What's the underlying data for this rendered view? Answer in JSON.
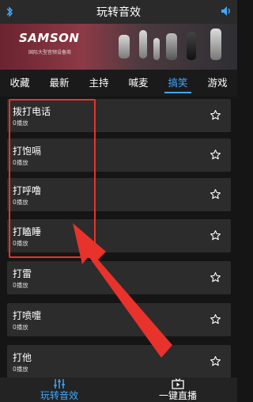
{
  "header": {
    "title": "玩转音效",
    "left_icon": "bluetooth-icon",
    "right_icon": "volume-icon"
  },
  "banner": {
    "brand": "SAMSON",
    "subtitle": "国际大型音频设备商"
  },
  "tabs": [
    {
      "label": "收藏",
      "active": false
    },
    {
      "label": "最新",
      "active": false
    },
    {
      "label": "主持",
      "active": false
    },
    {
      "label": "喊麦",
      "active": false
    },
    {
      "label": "搞笑",
      "active": true
    },
    {
      "label": "游戏",
      "active": false
    }
  ],
  "items": [
    {
      "name": "拨打电话",
      "count": "0播放",
      "icon": "star-outline-icon"
    },
    {
      "name": "打饱嗝",
      "count": "0播放",
      "icon": "star-outline-icon"
    },
    {
      "name": "打呼噜",
      "count": "0播放",
      "icon": "star-outline-icon"
    },
    {
      "name": "打瞌睡",
      "count": "0播放",
      "icon": "star-outline-icon"
    },
    {
      "name": "打雷",
      "count": "0播放",
      "icon": "star-outline-icon"
    },
    {
      "name": "打喷嚏",
      "count": "0播放",
      "icon": "star-outline-icon"
    },
    {
      "name": "打他",
      "count": "0播放",
      "icon": "star-outline-icon"
    }
  ],
  "bottom_nav": [
    {
      "label": "玩转音效",
      "icon": "equalizer-icon",
      "active": true
    },
    {
      "label": "一键直播",
      "icon": "tv-play-icon",
      "active": false
    }
  ],
  "colors": {
    "accent": "#41a8ff",
    "annotation": "#e8322c"
  }
}
